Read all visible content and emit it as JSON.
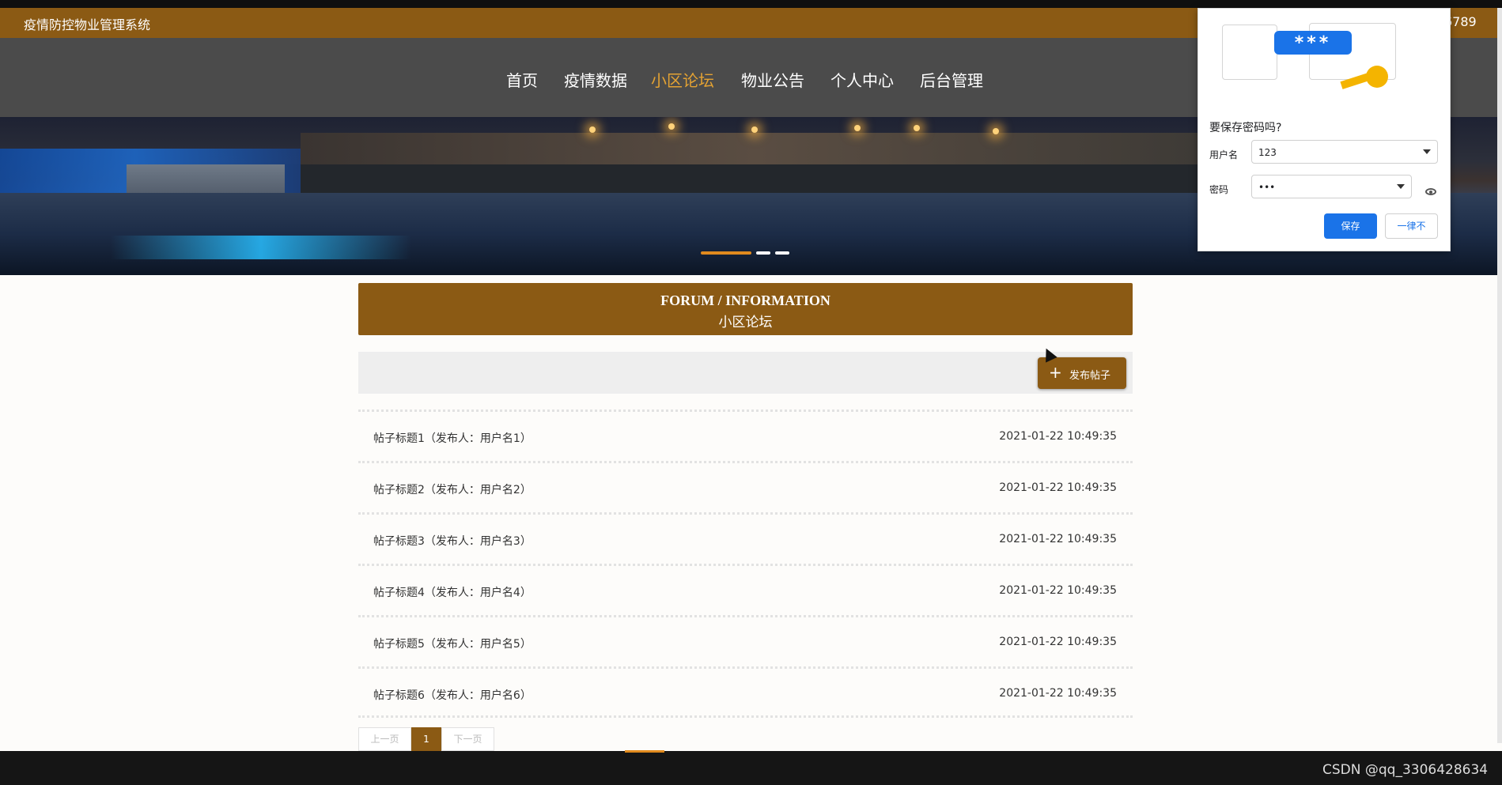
{
  "header": {
    "site_title": "疫情防控物业管理系统",
    "phone_suffix": "6789"
  },
  "nav": {
    "items": [
      {
        "label": "首页",
        "active": false
      },
      {
        "label": "疫情数据",
        "active": false
      },
      {
        "label": "小区论坛",
        "active": true
      },
      {
        "label": "物业公告",
        "active": false
      },
      {
        "label": "个人中心",
        "active": false
      },
      {
        "label": "后台管理",
        "active": false
      }
    ]
  },
  "section": {
    "title_en": "FORUM / INFORMATION",
    "title_cn": "小区论坛"
  },
  "toolbar": {
    "publish_label": "发布帖子"
  },
  "posts": [
    {
      "title": "帖子标题1（发布人：用户名1）",
      "time": "2021-01-22 10:49:35"
    },
    {
      "title": "帖子标题2（发布人：用户名2）",
      "time": "2021-01-22 10:49:35"
    },
    {
      "title": "帖子标题3（发布人：用户名3）",
      "time": "2021-01-22 10:49:35"
    },
    {
      "title": "帖子标题4（发布人：用户名4）",
      "time": "2021-01-22 10:49:35"
    },
    {
      "title": "帖子标题5（发布人：用户名5）",
      "time": "2021-01-22 10:49:35"
    },
    {
      "title": "帖子标题6（发布人：用户名6）",
      "time": "2021-01-22 10:49:35"
    }
  ],
  "pager": {
    "prev": "上一页",
    "current": "1",
    "next": "下一页"
  },
  "password_popup": {
    "title": "要保存密码吗?",
    "username_label": "用户名",
    "username_value": "123",
    "password_label": "密码",
    "password_value": "•••",
    "save_label": "保存",
    "never_label": "一律不",
    "masked_preview": "***"
  },
  "watermark": "CSDN @qq_3306428634",
  "colors": {
    "brand": "#8b5a14",
    "nav_active": "#e3a233",
    "nav_bg": "#4b4b4b",
    "popup_accent": "#1a73e8"
  }
}
